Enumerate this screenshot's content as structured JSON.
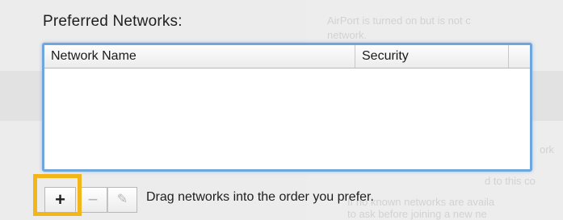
{
  "section_title": "Preferred Networks:",
  "table": {
    "columns": [
      "Network Name",
      "Security",
      ""
    ],
    "rows": []
  },
  "buttons": {
    "add_glyph": "+",
    "remove_glyph": "−",
    "edit_glyph": "✎"
  },
  "hint": "Drag networks into the order you prefer.",
  "background_text": {
    "airport_status": "AirPort is turned on but is not c",
    "airport_status_2": "network.",
    "known_networks": "ork",
    "join_notice": "d to this co",
    "available_notice": "If no known networks are availa",
    "available_notice_2": "to ask before joining a new ne"
  },
  "colors": {
    "focus_ring": "#6fa6de",
    "highlight": "#f3b61a"
  }
}
